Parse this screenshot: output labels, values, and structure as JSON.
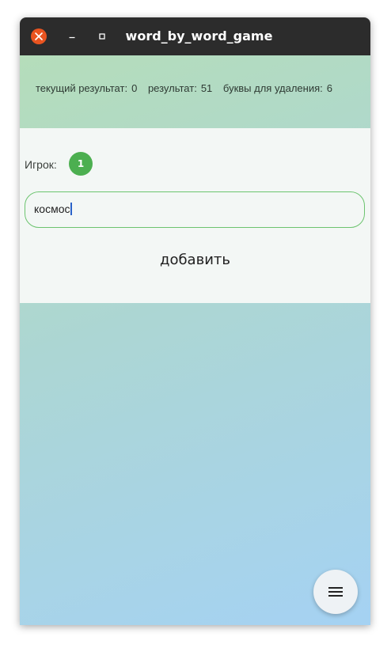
{
  "window": {
    "title": "word_by_word_game"
  },
  "status": {
    "current_result_label": "текущий результат:",
    "current_result_value": "0",
    "result_label": "результат:",
    "result_value": "51",
    "letters_to_remove_label": "буквы для удаления:",
    "letters_to_remove_value": "6"
  },
  "player": {
    "label": "Игрок:",
    "number": "1"
  },
  "word_input": {
    "value": "космос"
  },
  "add_button": {
    "label": "добавить"
  },
  "icons": {
    "close": "close-icon",
    "minimize": "minimize-icon",
    "maximize": "maximize-icon",
    "menu": "menu-icon"
  },
  "colors": {
    "titlebar": "#2c2c2c",
    "close_button": "#e95420",
    "player_badge": "#4caf50",
    "input_border": "#6cc46f",
    "caret": "#2a62c9"
  }
}
